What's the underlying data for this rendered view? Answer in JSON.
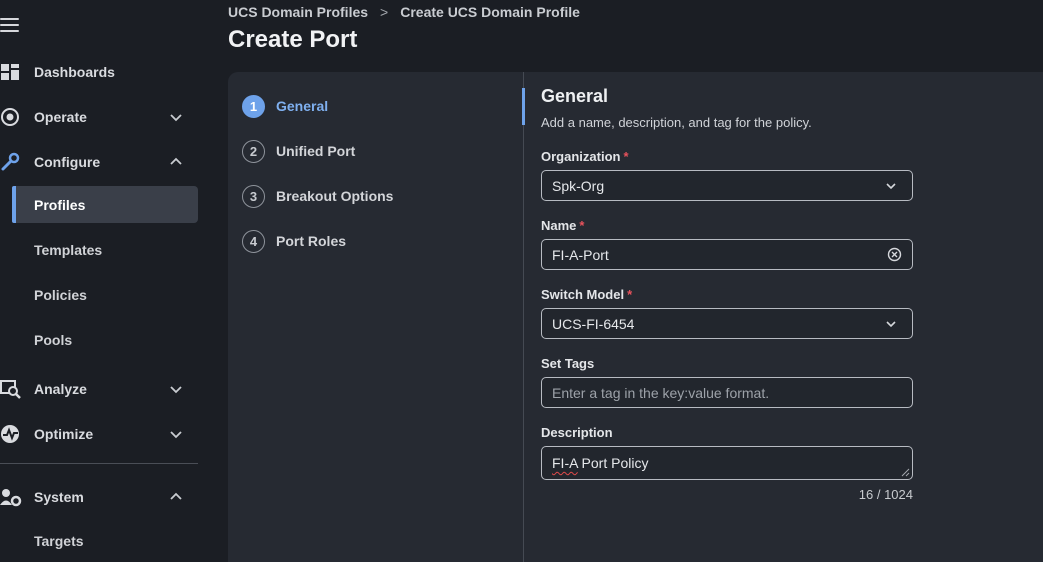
{
  "sidebar": {
    "items": [
      {
        "label": "Dashboards"
      },
      {
        "label": "Operate"
      },
      {
        "label": "Configure"
      },
      {
        "label": "Profiles"
      },
      {
        "label": "Templates"
      },
      {
        "label": "Policies"
      },
      {
        "label": "Pools"
      },
      {
        "label": "Analyze"
      },
      {
        "label": "Optimize"
      },
      {
        "label": "System"
      },
      {
        "label": "Targets"
      }
    ]
  },
  "header": {
    "breadcrumb": [
      "UCS Domain Profiles",
      "Create UCS Domain Profile"
    ],
    "breadcrumb_separator": ">",
    "title": "Create Port"
  },
  "steps": [
    {
      "num": "1",
      "label": "General"
    },
    {
      "num": "2",
      "label": "Unified Port"
    },
    {
      "num": "3",
      "label": "Breakout Options"
    },
    {
      "num": "4",
      "label": "Port Roles"
    }
  ],
  "form": {
    "title": "General",
    "description": "Add a name, description, and tag for the policy.",
    "organization": {
      "label": "Organization",
      "value": "Spk-Org"
    },
    "name": {
      "label": "Name",
      "value": "FI-A-Port"
    },
    "switch_model": {
      "label": "Switch Model",
      "value": "UCS-FI-6454"
    },
    "tags": {
      "label": "Set Tags",
      "placeholder": "Enter a tag in the key:value format."
    },
    "description_field": {
      "label": "Description",
      "value_prefix": "FI-A",
      "value_suffix": " Port Policy",
      "counter": "16 / 1024"
    },
    "required_mark": "*"
  },
  "colors": {
    "accent": "#6ea2ea",
    "required": "#e8525c",
    "background": "#1b1e24",
    "panel": "#262a32"
  }
}
